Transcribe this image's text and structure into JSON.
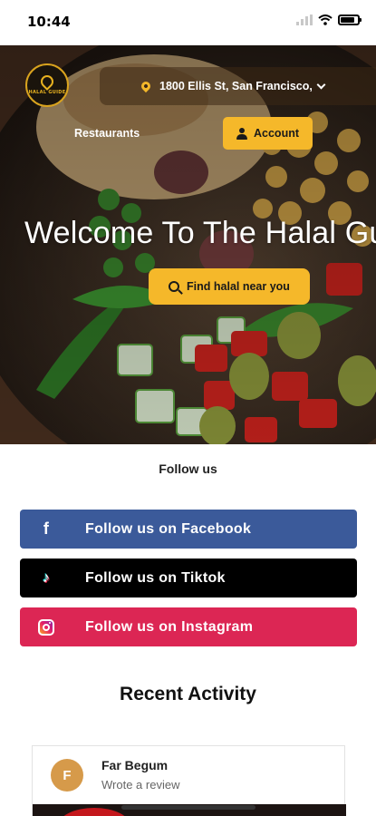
{
  "status_bar": {
    "time": "10:44"
  },
  "header": {
    "logo_text": "HALAL GUIDE",
    "location": "1800 Ellis St, San Francisco,",
    "nav_restaurants": "Restaurants",
    "account_label": "Account"
  },
  "hero": {
    "welcome": "Welcome To The Halal Gu",
    "find_button": "Find halal near you"
  },
  "follow": {
    "title": "Follow us",
    "facebook": "Follow us on Facebook",
    "tiktok": "Follow us on Tiktok",
    "instagram": "Follow us on Instagram"
  },
  "recent": {
    "title": "Recent Activity",
    "items": [
      {
        "initial": "F",
        "name": "Far Begum",
        "action": "Wrote a review"
      }
    ]
  },
  "colors": {
    "accent": "#f5b82a",
    "facebook": "#3b5a9a",
    "tiktok": "#000000",
    "instagram": "#dc2654"
  },
  "icons": [
    "wifi-icon",
    "battery-icon",
    "location-pin-icon",
    "chevron-down-icon",
    "user-icon",
    "search-icon",
    "facebook-icon",
    "tiktok-icon",
    "instagram-icon"
  ]
}
